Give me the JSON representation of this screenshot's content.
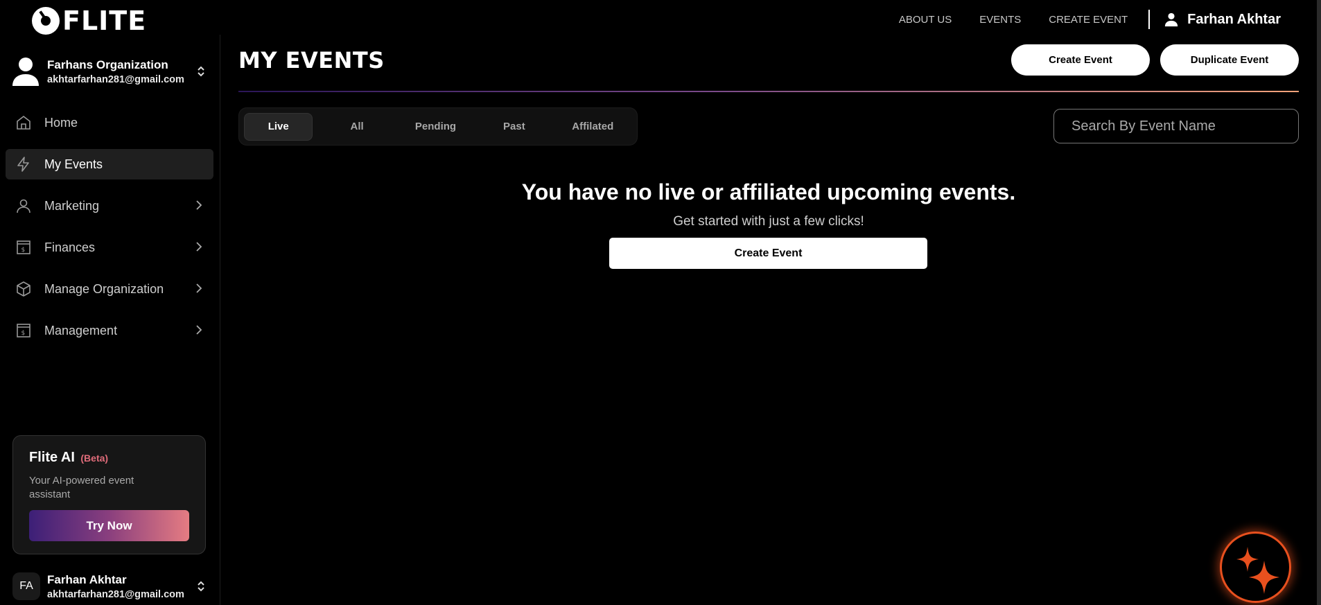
{
  "brand": {
    "name": "FLITE"
  },
  "topnav": {
    "links": [
      "ABOUT US",
      "EVENTS",
      "CREATE EVENT"
    ],
    "user_name": "Farhan Akhtar"
  },
  "sidebar": {
    "org": {
      "name": "Farhans Organization",
      "email": "akhtarfarhan281@gmail.com"
    },
    "items": [
      {
        "label": "Home",
        "icon": "home-icon",
        "active": false,
        "expandable": false
      },
      {
        "label": "My Events",
        "icon": "lightning-icon",
        "active": true,
        "expandable": false
      },
      {
        "label": "Marketing",
        "icon": "user-icon",
        "active": false,
        "expandable": true
      },
      {
        "label": "Finances",
        "icon": "receipt-icon",
        "active": false,
        "expandable": true
      },
      {
        "label": "Manage Organization",
        "icon": "box-icon",
        "active": false,
        "expandable": true
      },
      {
        "label": "Management",
        "icon": "receipt-icon",
        "active": false,
        "expandable": true
      }
    ],
    "ai_card": {
      "title": "Flite AI",
      "badge": "(Beta)",
      "description": "Your AI-powered event assistant",
      "button": "Try Now"
    },
    "account": {
      "initials": "FA",
      "name": "Farhan Akhtar",
      "email": "akhtarfarhan281@gmail.com"
    }
  },
  "main": {
    "title": "MY EVENTS",
    "create_button": "Create Event",
    "duplicate_button": "Duplicate Event",
    "tabs": [
      {
        "label": "Live",
        "active": true
      },
      {
        "label": "All",
        "active": false
      },
      {
        "label": "Pending",
        "active": false
      },
      {
        "label": "Past",
        "active": false
      },
      {
        "label": "Affilated",
        "active": false
      }
    ],
    "search": {
      "placeholder": "Search By Event Name",
      "value": ""
    },
    "empty_state": {
      "title": "You have no live or affiliated upcoming events.",
      "subtitle": "Get started with just a few clicks!",
      "button": "Create Event"
    }
  },
  "colors": {
    "background": "#000000",
    "accent_orange": "#e8501e",
    "beta_pink": "#e06c7a",
    "gradient_start": "#3c1f77",
    "gradient_end": "#e57c82"
  }
}
